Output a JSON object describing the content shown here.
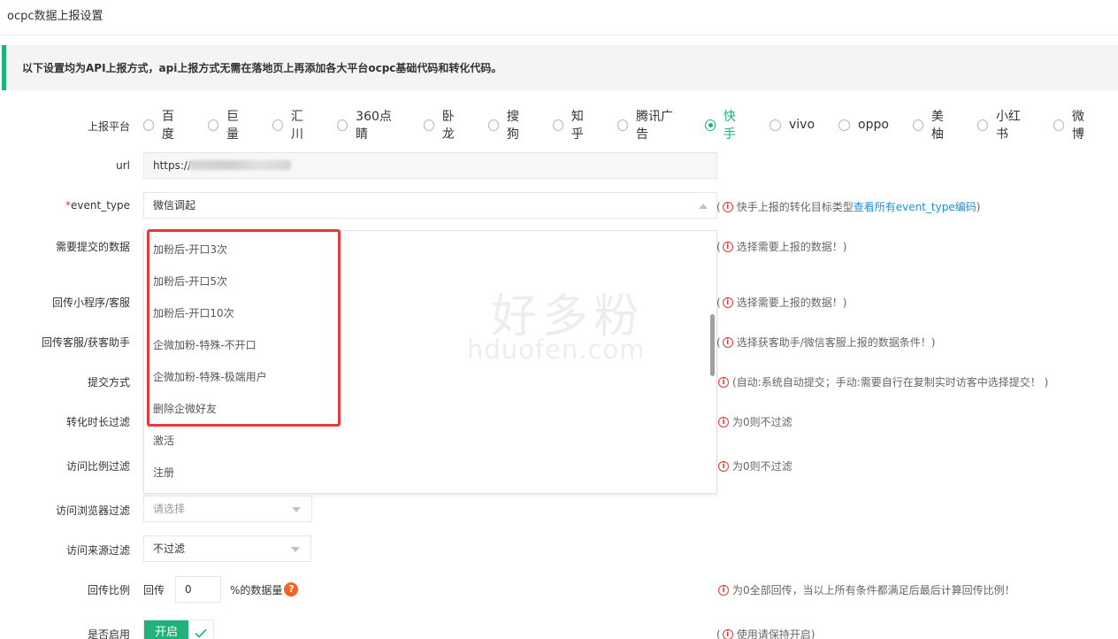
{
  "page": {
    "title": "ocpc数据上报设置"
  },
  "notice": {
    "text": "以下设置均为API上报方式，api上报方式无需在落地页上再添加各大平台ocpc基础代码和转化代码。"
  },
  "labels": {
    "platform": "上报平台",
    "url": "url",
    "event_type_required": "*",
    "event_type": "event_type",
    "submit_data": "需要提交的数据",
    "callback_miniapp": "回传小程序/客服",
    "callback_service": "回传客服/获客助手",
    "submit_method": "提交方式",
    "duration_filter": "转化时长过滤",
    "visit_ratio_filter": "访问比例过滤",
    "browser_filter": "访问浏览器过滤",
    "source_filter": "访问来源过滤",
    "callback_ratio": "回传比例",
    "enabled": "是否启用"
  },
  "platforms": [
    {
      "label": "百度",
      "checked": false
    },
    {
      "label": "巨量",
      "checked": false
    },
    {
      "label": "汇川",
      "checked": false
    },
    {
      "label": "360点睛",
      "checked": false
    },
    {
      "label": "卧龙",
      "checked": false
    },
    {
      "label": "搜狗",
      "checked": false
    },
    {
      "label": "知乎",
      "checked": false
    },
    {
      "label": "腾讯广告",
      "checked": false
    },
    {
      "label": "快手",
      "checked": true
    },
    {
      "label": "vivo",
      "checked": false
    },
    {
      "label": "oppo",
      "checked": false
    },
    {
      "label": "美柚",
      "checked": false
    },
    {
      "label": "小红书",
      "checked": false
    },
    {
      "label": "微博",
      "checked": false
    }
  ],
  "url": {
    "value": "https://"
  },
  "event_type": {
    "selected": "微信调起",
    "options": [
      "加粉后-开口3次",
      "加粉后-开口5次",
      "加粉后-开口10次",
      "企微加粉-特殊-不开口",
      "企微加粉-特殊-极端用户",
      "删除企微好友",
      "激活",
      "注册"
    ]
  },
  "hints": {
    "event_type_prefix": "快手上报的转化目标类型",
    "event_type_link": "查看所有event_type编码",
    "submit_data": "选择需要上报的数据！",
    "callback_miniapp": "选择需要上报的数据！",
    "callback_service": "选择获客助手/微信客服上报的数据条件！",
    "submit_method": "(自动:系统自动提交；手动:需要自行在复制实时访客中选择提交！ )",
    "duration_filter": "为0则不过滤",
    "visit_ratio_filter": "为0则不过滤",
    "callback_ratio": "为0全部回传，当以上所有条件都满足后最后计算回传比例！",
    "enabled": "使用请保持开启"
  },
  "browser_filter": {
    "placeholder": "请选择"
  },
  "source_filter": {
    "value": "不过滤"
  },
  "callback_ratio": {
    "prefix": "回传",
    "value": "0",
    "suffix": "%的数据量"
  },
  "enabled_switch": {
    "label": "开启"
  },
  "watermark": {
    "cn": "好多粉",
    "en": "hduofen.com"
  },
  "colors": {
    "accent": "#1fb27a",
    "link": "#1e90d6",
    "warning": "#e4393c",
    "highlight": "#e63a3a"
  }
}
